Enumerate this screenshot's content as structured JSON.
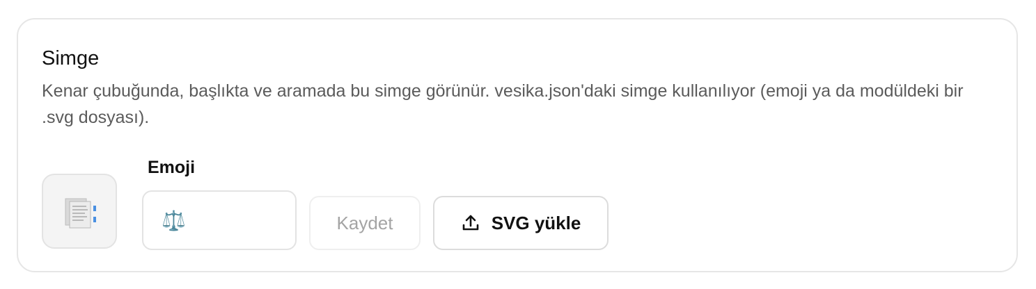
{
  "section": {
    "title": "Simge",
    "description": "Kenar çubuğunda, başlıkta ve aramada bu simge görünür. vesika.json'daki simge kullanılıyor (emoji ya da modüldeki bir .svg dosyası)."
  },
  "preview": {
    "icon_name": "document-icon"
  },
  "emoji_field": {
    "label": "Emoji",
    "value": "⚖️"
  },
  "actions": {
    "save_label": "Kaydet",
    "upload_label": "SVG yükle",
    "upload_icon": "upload-icon"
  }
}
